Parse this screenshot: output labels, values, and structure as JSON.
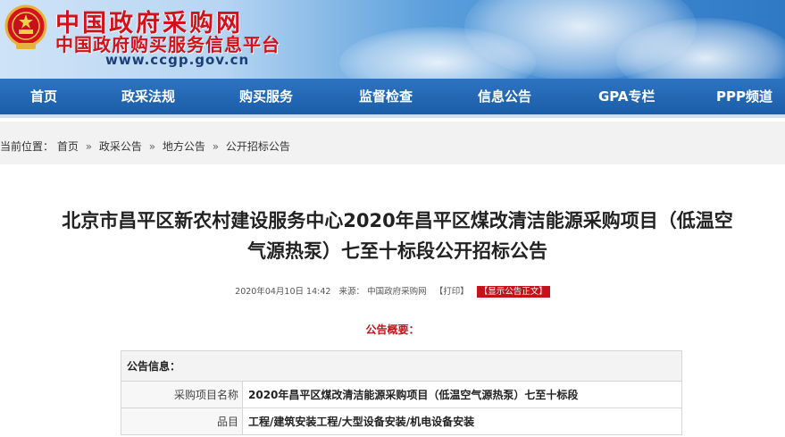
{
  "header": {
    "site_title": "中国政府采购网",
    "site_subtitle": "中国政府购买服务信息平台",
    "site_url": "www.ccgp.gov.cn",
    "colors": {
      "title_red": "#d0121b",
      "nav_blue": "#1b5da8"
    }
  },
  "nav": {
    "items": [
      {
        "label": "首页"
      },
      {
        "label": "政采法规"
      },
      {
        "label": "购买服务"
      },
      {
        "label": "监督检查"
      },
      {
        "label": "信息公告"
      },
      {
        "label": "GPA专栏"
      },
      {
        "label": "PPP频道"
      }
    ]
  },
  "breadcrumb": {
    "prefix": "当前位置：",
    "items": [
      "首页",
      "政采公告",
      "地方公告",
      "公开招标公告"
    ],
    "separator": "»"
  },
  "article": {
    "title_line1": "北京市昌平区新农村建设服务中心2020年昌平区煤改清洁能源采购项目（低温空",
    "title_line2": "气源热泵）七至十标段公开招标公告",
    "date": "2020年04月10日 14:42",
    "source_label": "来源：",
    "source": "中国政府采购网",
    "print_label": "【打印】",
    "show_label": "【显示公告正文】",
    "summary_heading": "公告概要："
  },
  "info_table": {
    "header": "公告信息：",
    "rows": [
      {
        "label": "采购项目名称",
        "value": "2020年昌平区煤改清洁能源采购项目（低温空气源热泵）七至十标段"
      },
      {
        "label": "品目",
        "value": "工程/建筑安装工程/大型设备安装/机电设备安装"
      }
    ]
  }
}
